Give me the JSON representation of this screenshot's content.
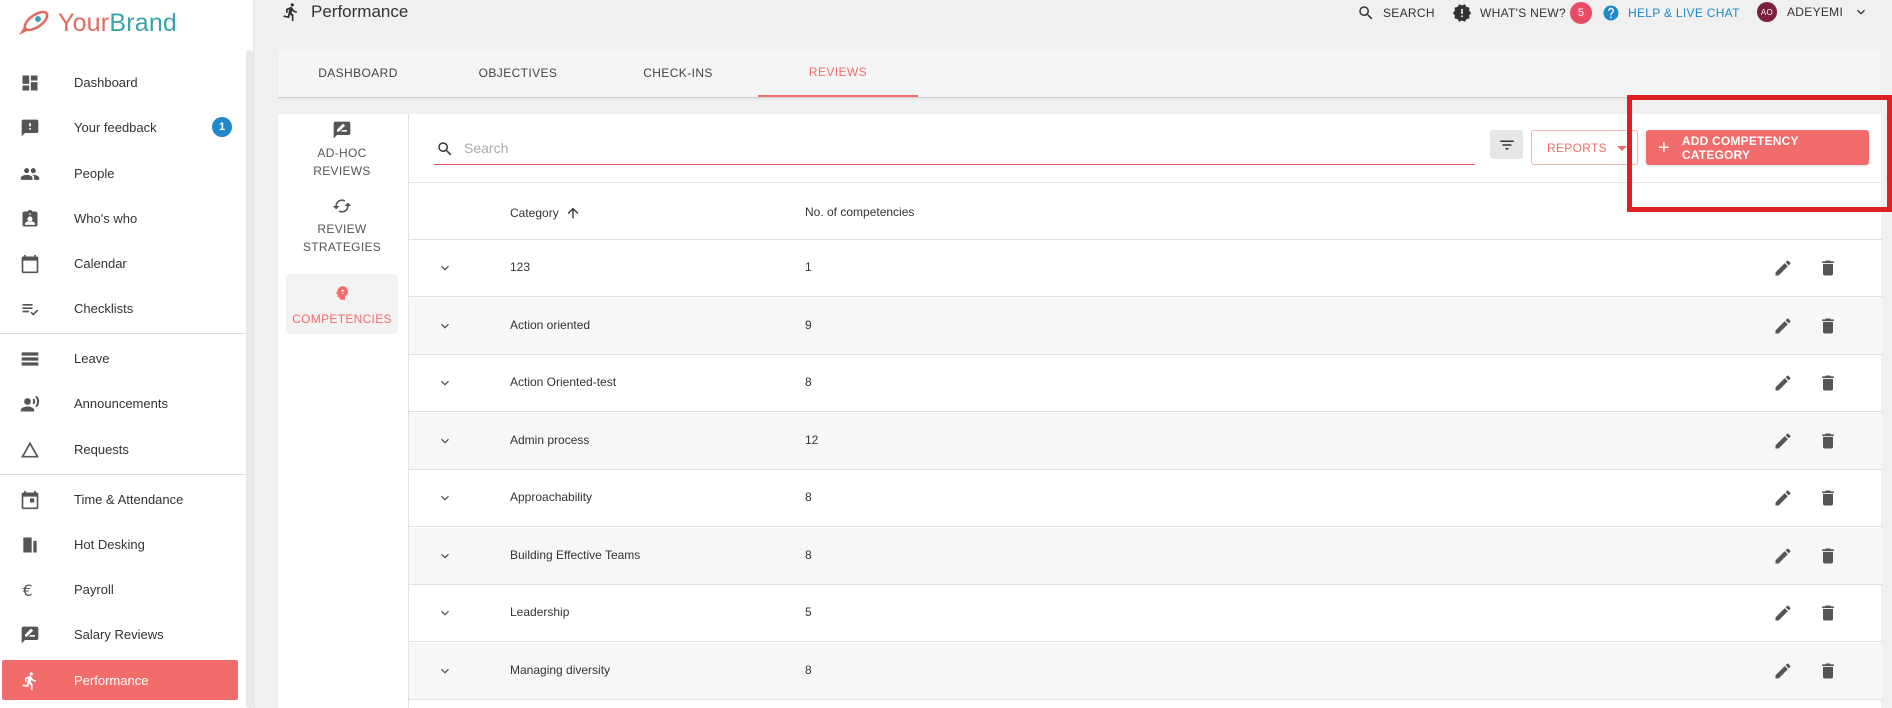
{
  "brand": {
    "part1": "Your",
    "part2": "Brand"
  },
  "sidebar": {
    "items": [
      {
        "label": "Dashboard",
        "icon": "dashboard-icon"
      },
      {
        "label": "Your feedback",
        "icon": "feedback-icon",
        "badge": "1"
      },
      {
        "label": "People",
        "icon": "people-icon"
      },
      {
        "label": "Who's who",
        "icon": "whos-who-icon"
      },
      {
        "label": "Calendar",
        "icon": "calendar-icon"
      },
      {
        "label": "Checklists",
        "icon": "checklist-icon"
      },
      {
        "label": "Leave",
        "icon": "leave-icon"
      },
      {
        "label": "Announcements",
        "icon": "announcement-icon"
      },
      {
        "label": "Requests",
        "icon": "requests-icon"
      },
      {
        "label": "Time & Attendance",
        "icon": "time-attendance-icon"
      },
      {
        "label": "Hot Desking",
        "icon": "hot-desking-icon"
      },
      {
        "label": "Payroll",
        "icon": "euro-icon"
      },
      {
        "label": "Salary Reviews",
        "icon": "salary-reviews-icon"
      },
      {
        "label": "Performance",
        "icon": "performance-icon"
      }
    ]
  },
  "header": {
    "title": "Performance",
    "search_label": "SEARCH",
    "whats_new_label": "WHAT'S NEW?",
    "whats_new_count": "5",
    "help_label": "HELP & LIVE CHAT",
    "user_initials": "AO",
    "user_name": "ADEYEMI"
  },
  "tabs": [
    "DASHBOARD",
    "OBJECTIVES",
    "CHECK-INS",
    "REVIEWS"
  ],
  "subnav": {
    "adhoc_line1": "AD-HOC",
    "adhoc_line2": "REVIEWS",
    "strategies_line1": "REVIEW",
    "strategies_line2": "STRATEGIES",
    "competencies": "COMPETENCIES"
  },
  "toolbar": {
    "search_placeholder": "Search",
    "reports_label": "REPORTS",
    "add_label": "ADD COMPETENCY CATEGORY"
  },
  "table": {
    "col_category": "Category",
    "col_count": "No. of competencies",
    "rows": [
      {
        "category": "123",
        "count": "1"
      },
      {
        "category": "Action oriented",
        "count": "9"
      },
      {
        "category": "Action Oriented-test",
        "count": "8"
      },
      {
        "category": "Admin process",
        "count": "12"
      },
      {
        "category": "Approachability",
        "count": "8"
      },
      {
        "category": "Building Effective Teams",
        "count": "8"
      },
      {
        "category": "Leadership",
        "count": "5"
      },
      {
        "category": "Managing diversity",
        "count": "8"
      }
    ]
  },
  "colors": {
    "accent": "#f26c6c",
    "help": "#1e88c8",
    "badge_blue": "#1e88c8",
    "badge_red": "#e84c65",
    "highlight": "#e02020"
  }
}
